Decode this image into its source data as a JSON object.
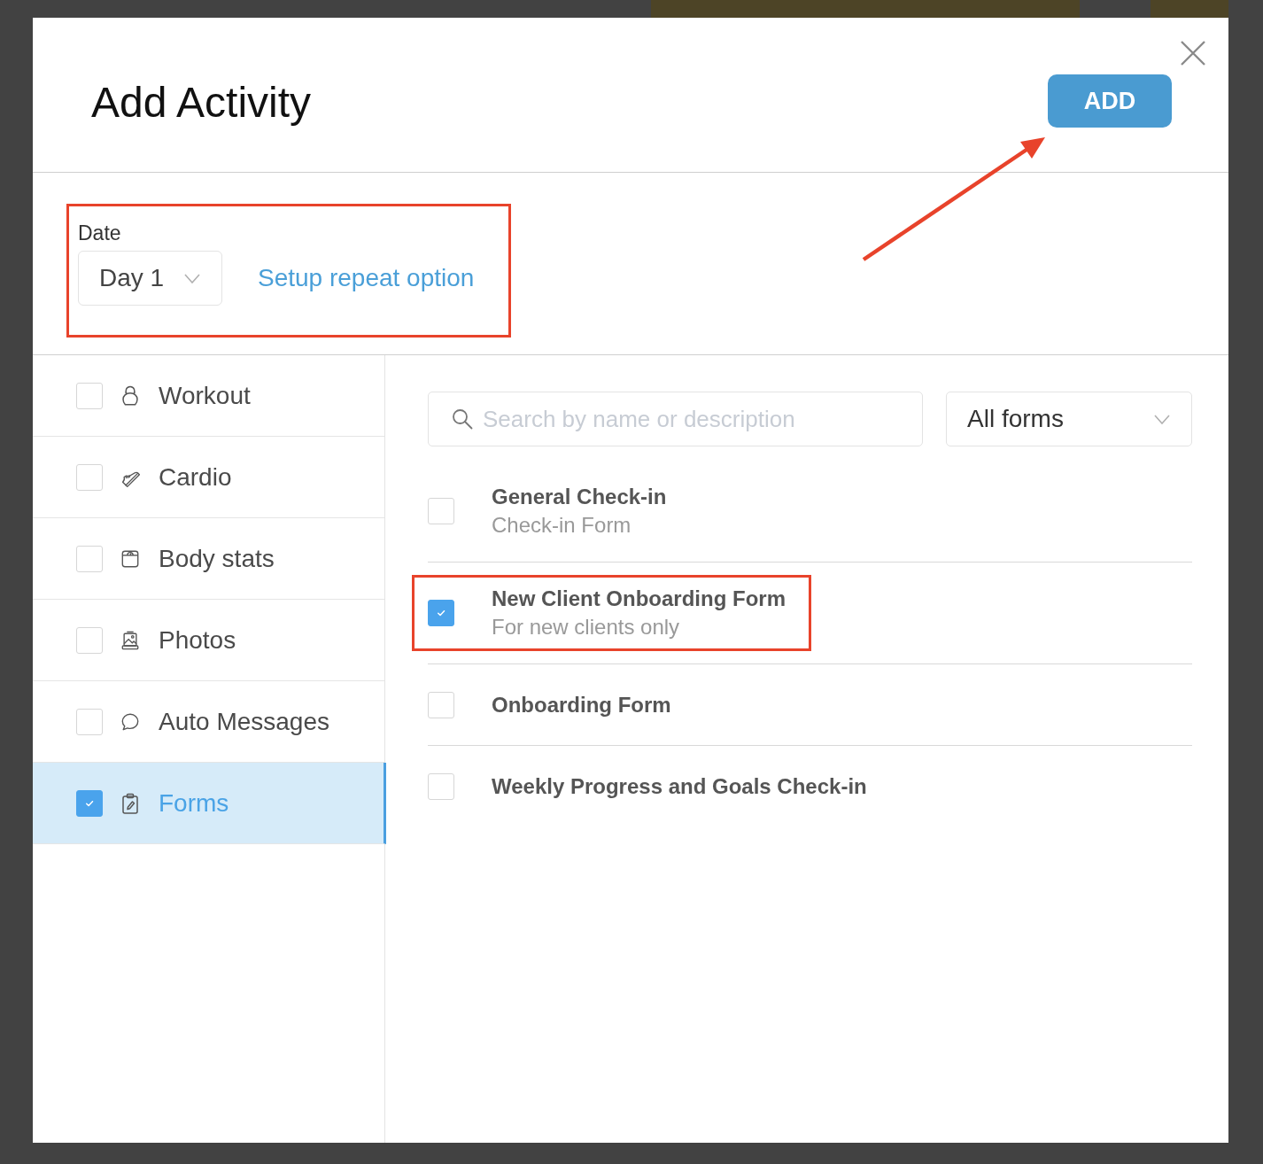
{
  "dialog": {
    "title": "Add Activity",
    "add_button": {
      "label": "ADD",
      "annotated": true
    }
  },
  "date": {
    "label": "Date",
    "value": "Day 1",
    "repeat_link": "Setup repeat option",
    "annotated": true
  },
  "activity_types": [
    {
      "kind": "workout",
      "label": "Workout",
      "checked": false,
      "selected": false
    },
    {
      "kind": "cardio",
      "label": "Cardio",
      "checked": false,
      "selected": false
    },
    {
      "kind": "bodystats",
      "label": "Body stats",
      "checked": false,
      "selected": false
    },
    {
      "kind": "photos",
      "label": "Photos",
      "checked": false,
      "selected": false
    },
    {
      "kind": "messages",
      "label": "Auto Messages",
      "checked": false,
      "selected": false
    },
    {
      "kind": "forms",
      "label": "Forms",
      "checked": true,
      "selected": true
    }
  ],
  "forms_panel": {
    "search": {
      "placeholder": "Search by name or description"
    },
    "filter": {
      "value": "All forms"
    },
    "forms": [
      {
        "title": "General Check-in",
        "subtitle": "Check-in Form",
        "checked": false,
        "annotated": false
      },
      {
        "title": "New Client Onboarding Form",
        "subtitle": "For new clients only",
        "checked": true,
        "annotated": true
      },
      {
        "title": "Onboarding Form",
        "checked": false,
        "annotated": false
      },
      {
        "title": "Weekly Progress and Goals Check-in",
        "checked": false,
        "annotated": false
      }
    ]
  }
}
